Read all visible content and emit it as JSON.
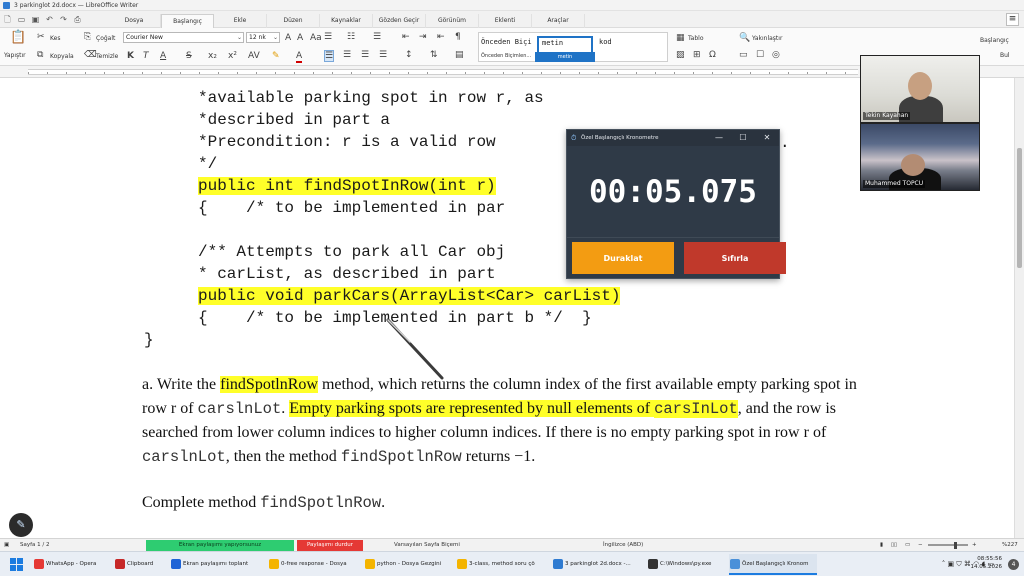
{
  "window": {
    "title": "3 parkinglot 2d.docx — LibreOffice Writer"
  },
  "menu": {
    "tabs": [
      "Dosya",
      "Başlangıç",
      "Ekle",
      "Düzen",
      "Kaynaklar",
      "Gözden Geçir",
      "Görünüm",
      "Eklenti",
      "Araçlar"
    ],
    "active_tab": "Başlangıç"
  },
  "ribbon": {
    "paste": "Yapıştır",
    "cut": "Kes",
    "copy": "Kopyala",
    "clone": "Çoğalt",
    "clear": "Temizle",
    "font_name": "Courier New",
    "font_size": "12 nk",
    "styles": [
      "Önceden Biçi",
      "metin",
      "kod"
    ],
    "styles_caption": "Önceden Biçimlen...",
    "style_selected_label": "metin",
    "table": "Tablo",
    "find": "Yakınlaştır",
    "right_label": "Başlangıç",
    "find_btn": "Bul"
  },
  "document": {
    "code_lines": [
      {
        "text": "*available parking spot in row r, as",
        "hl": false
      },
      {
        "text": "*described in part a",
        "hl": false
      },
      {
        "text": "*Precondition: r is a valid row",
        "hl": false
      },
      {
        "text": "*/",
        "hl": false
      },
      {
        "text": "public int findSpotInRow(int r)",
        "hl": true
      },
      {
        "text": "{    /* to be implemented in par",
        "hl": false
      },
      {
        "text": "",
        "hl": false
      },
      {
        "text": "/** Attempts to park all Car obj",
        "hl": false
      },
      {
        "text": "* carList, as described in part",
        "hl": false
      },
      {
        "text": "public void parkCars(ArrayList<Car> carList)",
        "hl": true
      },
      {
        "text": "{    /* to be implemented in part b */  }",
        "hl": false
      }
    ],
    "code_tail": ".",
    "closing_brace": "}",
    "prose": {
      "p1_a": "a. Write the ",
      "p1_method": "findSpotlnRow",
      "p1_b": " method, which returns the column index of the first available empty parking spot in row r of ",
      "p1_mono1": "carslnLot",
      "p1_c": ". ",
      "p1_hl": "Empty parking spots are represented by null elements of ",
      "p1_hl_mono": "carsInLot",
      "p1_d": ", and the row is searched from lower column indices to higher column indices. If there is no empty parking spot in row r of ",
      "p1_mono2": "carslnLot",
      "p1_e": ", then the method ",
      "p1_mono3": "findSpotlnRow",
      "p1_f": "  returns −1.",
      "p2_a": "Complete method ",
      "p2_mono": "findSpotlnRow",
      "p2_b": "."
    }
  },
  "stopwatch": {
    "title": "Özel Başlangıçlı Kronometre",
    "time": "00:05.075",
    "pause_label": "Duraklat",
    "reset_label": "Sıfırla",
    "minimize": "—",
    "maximize": "☐",
    "close": "✕"
  },
  "video": {
    "participant1": "Tekin Kayahan",
    "participant2": "Muhammed TOPCU"
  },
  "statusbar": {
    "page": "Sayfa 1 / 2",
    "sharing": "Ekran paylaşımı yapıyorsunuz",
    "stop_sharing": "Paylaşımı durdur",
    "page_style": "Varsayılan Sayfa Biçemi",
    "language": "İngilizce (ABD)",
    "zoom": "%227"
  },
  "taskbar": {
    "items": [
      {
        "label": "WhatsApp - Opera",
        "color": "#e53935"
      },
      {
        "label": "Clipboard",
        "color": "#c62828"
      },
      {
        "label": "Ekran paylaşımı toplant",
        "color": "#1e63d6"
      },
      {
        "label": "0-free response - Dosya",
        "color": "#f4b400"
      },
      {
        "label": "python - Dosya Gezgini",
        "color": "#f4b400"
      },
      {
        "label": "3-class, method soru çö",
        "color": "#f4b400"
      },
      {
        "label": "3 parkinglot 2d.docx -...",
        "color": "#2f7bd1"
      },
      {
        "label": "C:\\Windows\\py.exe",
        "color": "#333333"
      },
      {
        "label": "Özel Başlangıçlı Kronom",
        "color": "#4a90d9"
      }
    ],
    "active_index": 8,
    "time": "08:55:56",
    "date": "14.05.2026",
    "notif": "4"
  },
  "colors": {
    "highlight": "#ffff29",
    "pause_button": "#f39c12",
    "reset_button": "#c0392b",
    "share_green": "#2ecc71",
    "share_red": "#e53935"
  }
}
